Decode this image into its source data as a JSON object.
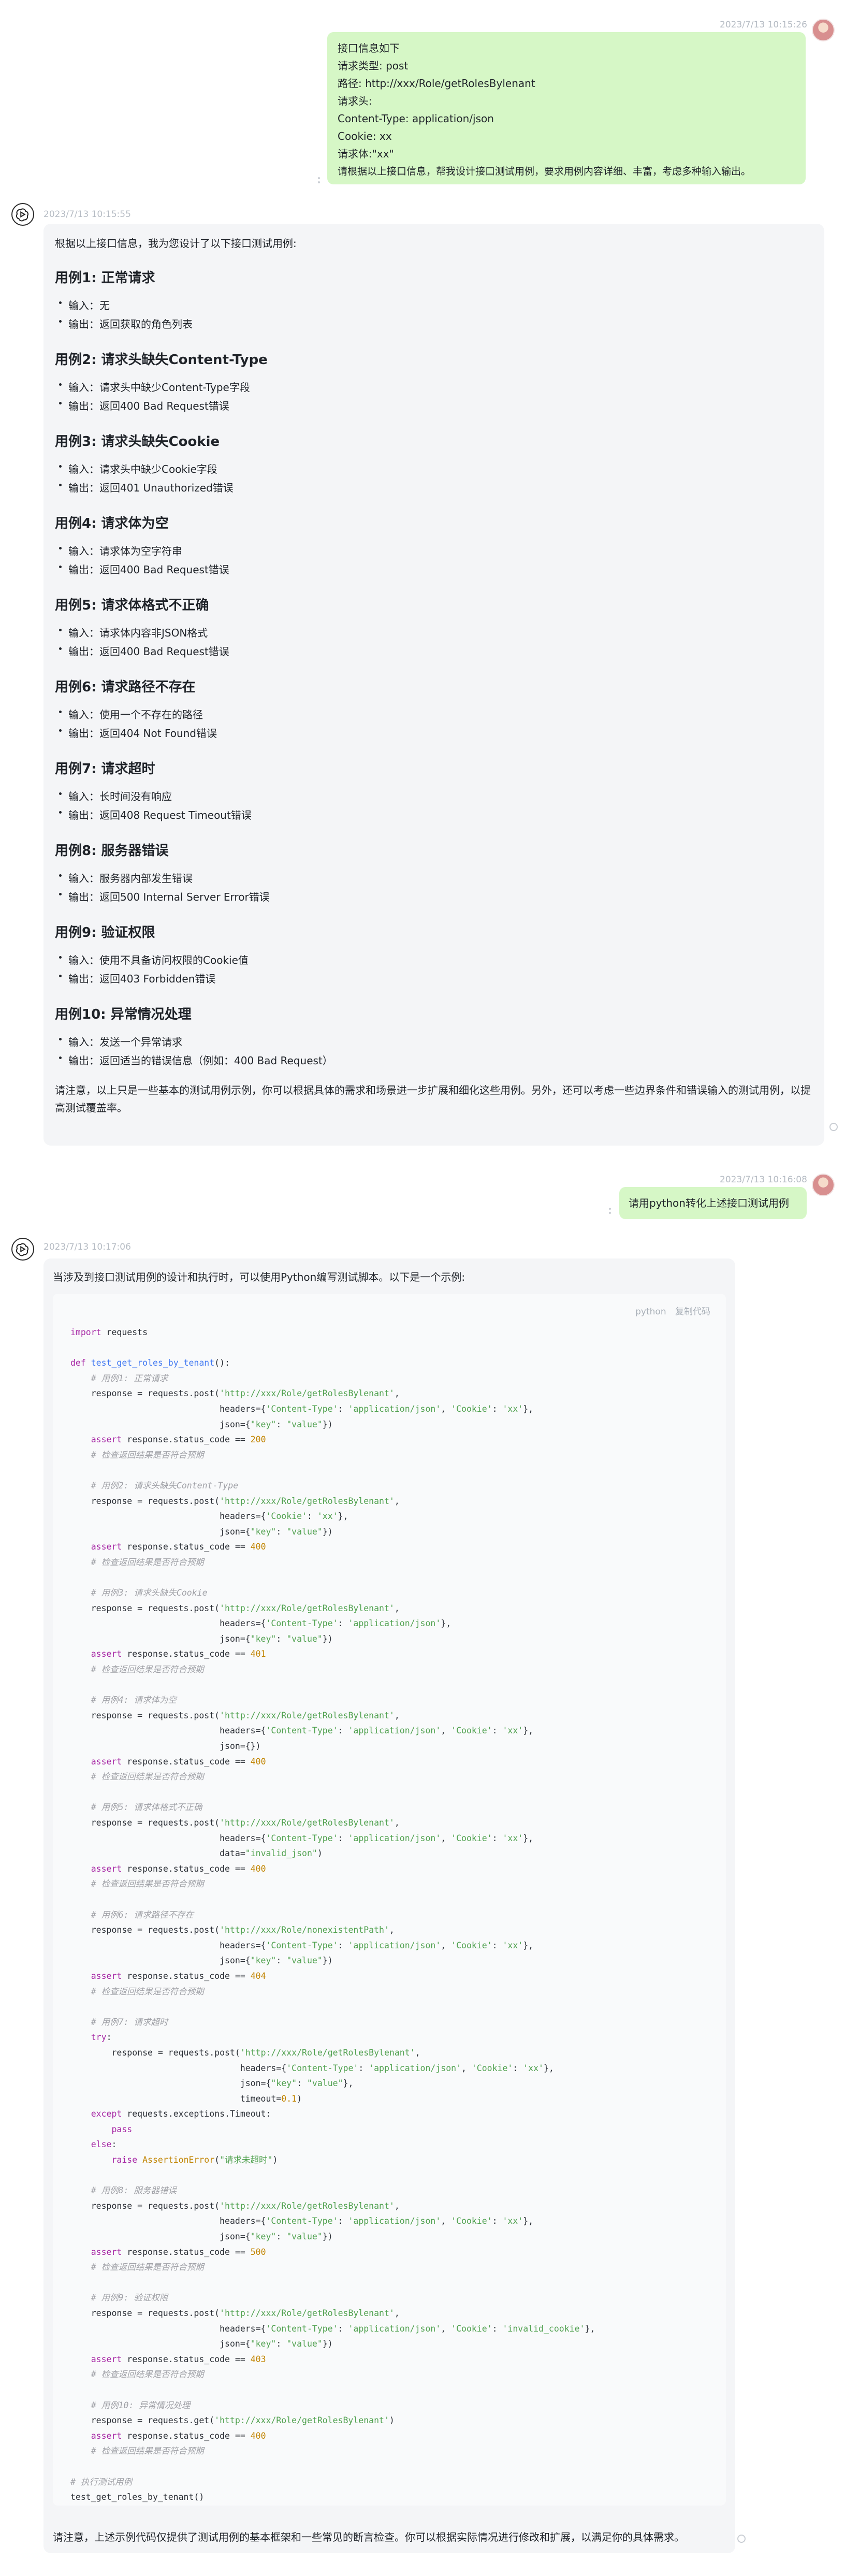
{
  "messages": {
    "user1": {
      "time": "2023/7/13 10:15:26",
      "lines": [
        "接口信息如下",
        "请求类型: post",
        "路径: http://xxx/Role/getRolesBylenant",
        "请求头:",
        "Content-Type: application/json",
        "Cookie: xx",
        "请求体:\"xx\"",
        "请根据以上接口信息，帮我设计接口测试用例，要求用例内容详细、丰富，考虑多种输入输出。"
      ]
    },
    "bot1": {
      "time": "2023/7/13 10:15:55",
      "intro": "根据以上接口信息，我为您设计了以下接口测试用例:",
      "cases": [
        {
          "title": "用例1: 正常请求",
          "input": "输入：无",
          "output": "输出：返回获取的角色列表"
        },
        {
          "title": "用例2: 请求头缺失Content-Type",
          "input": "输入：请求头中缺少Content-Type字段",
          "output": "输出：返回400 Bad Request错误"
        },
        {
          "title": "用例3: 请求头缺失Cookie",
          "input": "输入：请求头中缺少Cookie字段",
          "output": "输出：返回401 Unauthorized错误"
        },
        {
          "title": "用例4: 请求体为空",
          "input": "输入：请求体为空字符串",
          "output": "输出：返回400 Bad Request错误"
        },
        {
          "title": "用例5: 请求体格式不正确",
          "input": "输入：请求体内容非JSON格式",
          "output": "输出：返回400 Bad Request错误"
        },
        {
          "title": "用例6: 请求路径不存在",
          "input": "输入：使用一个不存在的路径",
          "output": "输出：返回404 Not Found错误"
        },
        {
          "title": "用例7: 请求超时",
          "input": "输入：长时间没有响应",
          "output": "输出：返回408 Request Timeout错误"
        },
        {
          "title": "用例8: 服务器错误",
          "input": "输入：服务器内部发生错误",
          "output": "输出：返回500 Internal Server Error错误"
        },
        {
          "title": "用例9: 验证权限",
          "input": "输入：使用不具备访问权限的Cookie值",
          "output": "输出：返回403 Forbidden错误"
        },
        {
          "title": "用例10: 异常情况处理",
          "input": "输入：发送一个异常请求",
          "output": "输出：返回适当的错误信息（例如：400 Bad Request）"
        }
      ],
      "outro": "请注意，以上只是一些基本的测试用例示例，你可以根据具体的需求和场景进一步扩展和细化这些用例。另外，还可以考虑一些边界条件和错误输入的测试用例，以提高测试覆盖率。"
    },
    "user2": {
      "time": "2023/7/13 10:16:08",
      "text": "请用python转化上述接口测试用例"
    },
    "bot2": {
      "time": "2023/7/13 10:17:06",
      "intro": "当涉及到接口测试用例的设计和执行时，可以使用Python编写测试脚本。以下是一个示例:",
      "code_lang": "python",
      "copy_label": "复制代码",
      "outro": "请注意，上述示例代码仅提供了测试用例的基本框架和一些常见的断言检查。你可以根据实际情况进行修改和扩展，以满足你的具体需求。"
    }
  },
  "icons": {
    "user_avatar": "user-avatar",
    "bot_avatar": "openai-logo-icon",
    "status": "circle-icon",
    "more": "more-vertical-icon"
  },
  "colors": {
    "user_bubble": "#d6f7c6",
    "bot_card": "#f4f5f7"
  }
}
